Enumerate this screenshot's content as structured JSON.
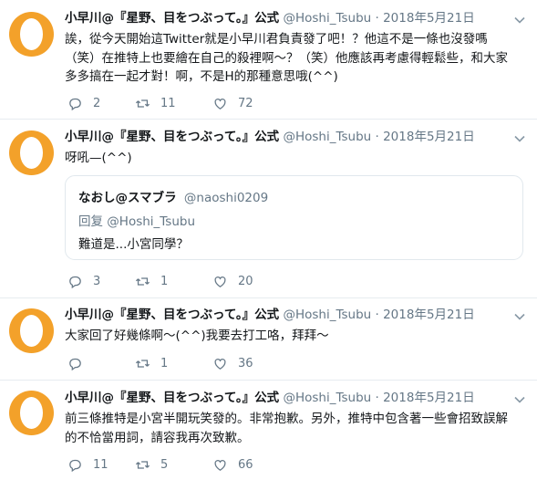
{
  "tweets": [
    {
      "name": "小早川@『星野、目をつぶって。』公式",
      "handle": "@Hoshi_Tsubu",
      "date": "2018年5月21日",
      "lines": [
        "誒，從今天開始這Twitter就是小早川君負責發了吧！？他這不是一條也沒發嗎",
        "（笑）在推特上也要繪在自己的殺裡啊～？（笑）他應該再考慮得輕鬆些，和大家",
        "多多搞在一起才對！啊，不是H的那種意思哦(^^)"
      ],
      "replies": "2",
      "retweets": "11",
      "likes": "72"
    },
    {
      "name": "小早川@『星野、目をつぶって。』公式",
      "handle": "@Hoshi_Tsubu",
      "date": "2018年5月21日",
      "lines": [
        "呀吼—(^^)"
      ],
      "quote": {
        "name": "なおし@スマブラ",
        "handle": "@naoshi0209",
        "reply_to": "回复 @Hoshi_Tsubu",
        "text": "難道是...小宮同學？"
      },
      "replies": "3",
      "retweets": "1",
      "likes": "20"
    },
    {
      "name": "小早川@『星野、目をつぶって。』公式",
      "handle": "@Hoshi_Tsubu",
      "date": "2018年5月21日",
      "lines": [
        "大家回了好幾條啊～(^^)我要去打工咯，拜拜～"
      ],
      "replies": "",
      "retweets": "1",
      "likes": "36"
    },
    {
      "name": "小早川@『星野、目をつぶって。』公式",
      "handle": "@Hoshi_Tsubu",
      "date": "2018年5月21日",
      "lines": [
        "前三條推特是小宮半開玩笑發的。非常抱歉。另外，推特中包含著一些會招致誤解",
        "的不恰當用詞，請容我再次致歉。"
      ],
      "replies": "11",
      "retweets": "5",
      "likes": "66"
    }
  ],
  "separator": "·",
  "icons": {
    "reply": "reply-icon",
    "retweet": "retweet-icon",
    "like": "heart-icon",
    "caret": "chevron-down-icon"
  },
  "colors": {
    "avatar": "#f3a12a",
    "muted": "#657786",
    "text": "#14171a",
    "border": "#e6ecf0"
  }
}
